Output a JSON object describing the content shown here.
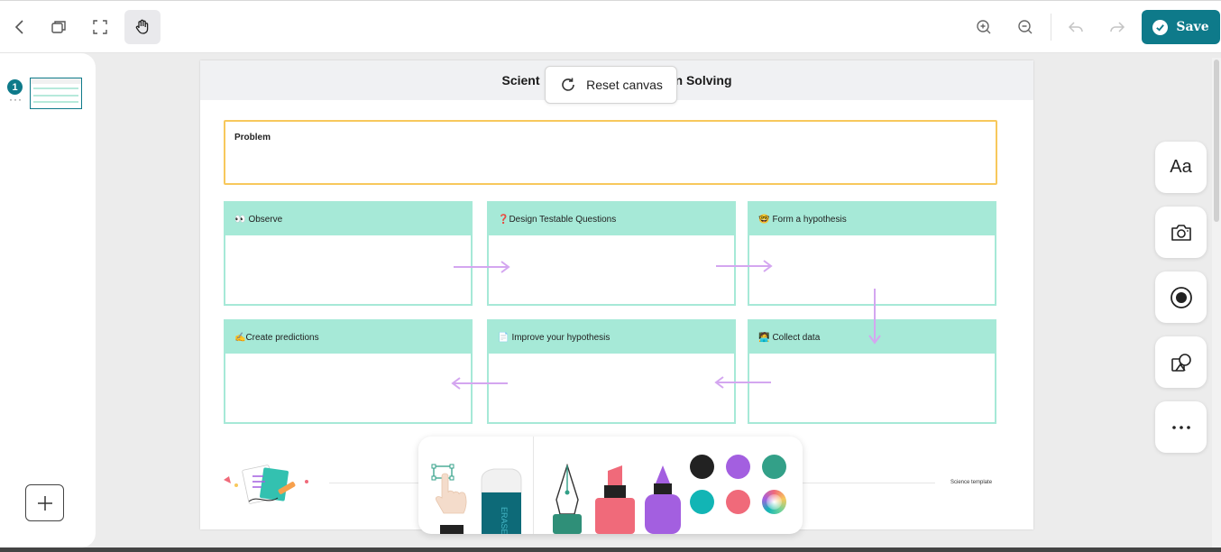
{
  "toolbar": {
    "save_label": "Save",
    "buttons": [
      "back-icon",
      "pages-icon",
      "fullscreen-icon",
      "hand-tool-icon",
      "zoom-in-icon",
      "zoom-out-icon",
      "undo-icon",
      "redo-icon"
    ],
    "accent_color": "#0e7a8a"
  },
  "pages": {
    "current_page": "1",
    "more": "···"
  },
  "canvas": {
    "title_left": "Scient",
    "title_right": "n Solving",
    "reset_label": "Reset canvas",
    "problem_label": "Problem",
    "steps": [
      {
        "emoji": "👀",
        "label": "Observe"
      },
      {
        "emoji": "❓",
        "label": "Design Testable Questions"
      },
      {
        "emoji": "🤓",
        "label": "Form a hypothesis"
      },
      {
        "emoji": "✍️",
        "label": "Create predictions"
      },
      {
        "emoji": "📄",
        "label": "Improve your hypothesis"
      },
      {
        "emoji": "🧑‍💻",
        "label": "Collect data"
      }
    ],
    "footer_text": "Science template",
    "colors": {
      "problem_border": "#f7c85c",
      "step_fill": "#a6e9d7",
      "arrow": "#d4a6f0"
    }
  },
  "right_tools": [
    "text-icon",
    "camera-icon",
    "record-icon",
    "shapes-icon",
    "more-icon"
  ],
  "right_tools_text": {
    "text_tool": "Aa"
  },
  "tray": {
    "tools": [
      "select-hand-tool",
      "eraser-tool",
      "pen-tool",
      "marker-tool",
      "highlighter-tool"
    ],
    "eraser_text": "ERASER",
    "swatches": [
      "#222222",
      "#a35fe0",
      "#33a088",
      "#12b5b5",
      "#f06a7a",
      "rainbow"
    ]
  }
}
